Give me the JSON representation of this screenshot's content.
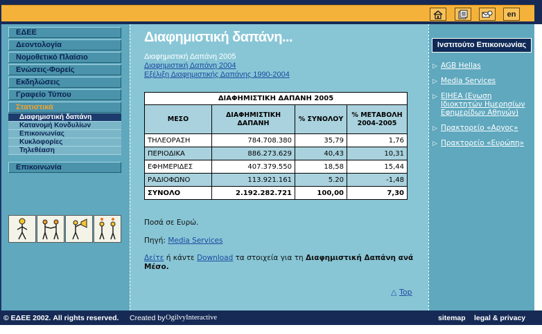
{
  "header": {
    "icons": [
      "home-icon",
      "sitemap-icon",
      "contact-icon",
      "language-en-icon"
    ],
    "lang_label": "en"
  },
  "sidebar": {
    "items": [
      {
        "label": "ΕΔΕΕ"
      },
      {
        "label": "Δεοντολογία"
      },
      {
        "label": "Νομοθετικό Πλαίσιο"
      },
      {
        "label": "Ενώσεις-Φορείς"
      },
      {
        "label": "Εκδηλώσεις"
      },
      {
        "label": "Γραφείο Τύπου"
      },
      {
        "label": "Στατιστικά"
      }
    ],
    "subitems": [
      {
        "label": "Διαφημιστική δαπάνη"
      },
      {
        "label": "Κατανομή Κονδυλίων"
      },
      {
        "label": "Επικοινωνίας"
      },
      {
        "label": "Κυκλοφορίες"
      },
      {
        "label": "Τηλεθέαση"
      }
    ],
    "contact_label": "Επικοινωνία"
  },
  "main": {
    "title": "Διαφημιστική δαπάνη...",
    "current_link": "Διαφημιστική Δαπάνη 2005",
    "links": [
      "Διαφημιστική Δαπάνη 2004",
      "Εξέλιξη Διαφημιστικής Δαπάνης 1990-2004"
    ],
    "table": {
      "caption": "ΔΙΑΦΗΜΙΣΤΙΚΗ ΔΑΠΑΝΗ 2005",
      "headers": [
        "ΜΕΣΟ",
        "ΔΙΑΦΗΜΙΣΤΙΚΗ ΔΑΠΑΝΗ",
        "% ΣΥΝΟΛΟΥ",
        "% ΜΕΤΑΒΟΛΗ 2004-2005"
      ],
      "rows": [
        [
          "ΤΗΛΕΟΡΑΣΗ",
          "784.708.380",
          "35,79",
          "1,76"
        ],
        [
          "ΠΕΡΙΟΔΙΚΑ",
          "886.273.629",
          "40,43",
          "10,31"
        ],
        [
          "ΕΦΗΜΕΡΙΔΕΣ",
          "407.379.550",
          "18,58",
          "15,44"
        ],
        [
          "ΡΑΔΙΟΦΩΝΟ",
          "113.921.161",
          "5.20",
          "-1,48"
        ]
      ],
      "total": [
        "ΣΥΝΟΛΟ",
        "2.192.282.721",
        "100,00",
        "7,30"
      ]
    },
    "currency_note": "Ποσά σε Ευρώ.",
    "source_label": "Πηγή:",
    "source_link": "Media Services",
    "download": {
      "see_link": "Δείτε",
      "middle": " ή κάντε ",
      "download_link": "Download",
      "rest": " τα στοιχεία για τη ",
      "bold": "Διαφημιστική Δαπάνη ανά Μέσο",
      "end": "."
    },
    "top_link": "Top",
    "top_icon": "triangle-up-icon"
  },
  "right": {
    "heading": "Ινστιτούτο Επικοινωνίας",
    "links": [
      "AGB Hellas",
      "Media Services",
      "ΕΙΗΕΑ (Ενωση Ιδιοκτητών Ημερησίων Εφημερίδων Αθηνών)",
      "Πρακτορείο «Αργος»",
      "Πρακτορείο «Ευρώπη»"
    ]
  },
  "footer": {
    "copyright": "© ΕΔΕΕ 2002. All rights reserved.",
    "created_by": "Created by",
    "agency": "OgilvyInteractive",
    "sitemap": "sitemap",
    "legal": "legal & privacy"
  },
  "colors": {
    "navy": "#162a55",
    "orange": "#f4b23a",
    "teal": "#5fa8be",
    "light_teal": "#88c6d6",
    "table_header": "#a9d2de",
    "link": "#1b4aa0",
    "active_menu": "#f2a22c"
  }
}
